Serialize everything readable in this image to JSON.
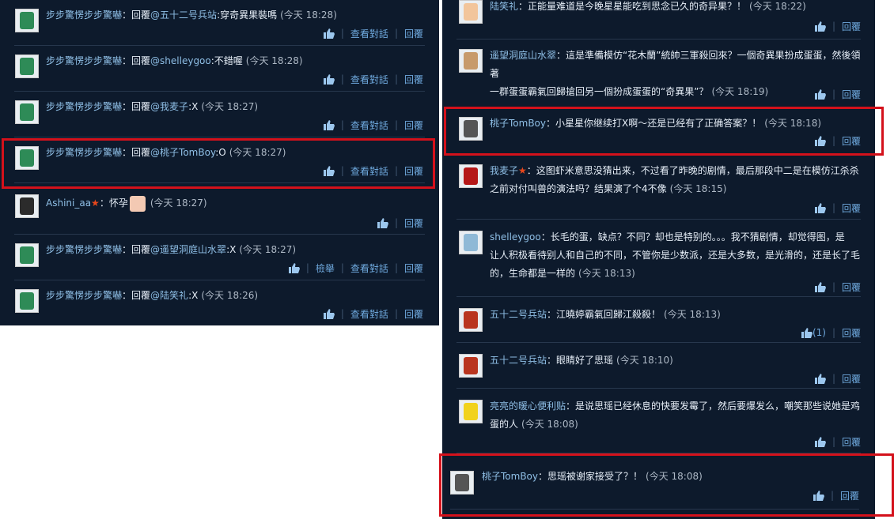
{
  "left": [
    {
      "name": "步步驚愣步步驚嚇",
      "sep": "：",
      "parts": [
        {
          "t": "回覆",
          "c": "text"
        },
        {
          "t": "@五十二号兵站",
          "c": "mention"
        },
        {
          "t": ":穿奇異果裝嗎",
          "c": "text"
        }
      ],
      "time": "(今天 18:28)",
      "actions": [
        "查看對話",
        "回覆"
      ],
      "avatar": "bottle"
    },
    {
      "name": "步步驚愣步步驚嚇",
      "sep": "：",
      "parts": [
        {
          "t": "回覆",
          "c": "text"
        },
        {
          "t": "@shelleygoo",
          "c": "mention"
        },
        {
          "t": ":不錯喔",
          "c": "text"
        }
      ],
      "time": "(今天 18:28)",
      "actions": [
        "查看對話",
        "回覆"
      ],
      "avatar": "bottle"
    },
    {
      "name": "步步驚愣步步驚嚇",
      "sep": "：",
      "parts": [
        {
          "t": "回覆",
          "c": "text"
        },
        {
          "t": "@我麦子",
          "c": "mention"
        },
        {
          "t": ":X",
          "c": "text"
        }
      ],
      "time": "(今天 18:27)",
      "actions": [
        "查看對話",
        "回覆"
      ],
      "avatar": "bottle"
    },
    {
      "name": "步步驚愣步步驚嚇",
      "sep": "：",
      "parts": [
        {
          "t": "回覆",
          "c": "text"
        },
        {
          "t": "@桃子TomBoy",
          "c": "mention"
        },
        {
          "t": ":O",
          "c": "text"
        }
      ],
      "time": "(今天 18:27)",
      "actions": [
        "查看對話",
        "回覆"
      ],
      "avatar": "bottle"
    },
    {
      "name": "Ashini_aa",
      "star": "★",
      "sep": "：",
      "parts": [
        {
          "t": "怀孕",
          "c": "text"
        }
      ],
      "emoji": true,
      "time": "(今天 18:27)",
      "actions": [
        "回覆"
      ],
      "avatar": "dark"
    },
    {
      "name": "步步驚愣步步驚嚇",
      "sep": "：",
      "parts": [
        {
          "t": "回覆",
          "c": "text"
        },
        {
          "t": "@遥望洞庭山水翠",
          "c": "mention"
        },
        {
          "t": ":X",
          "c": "text"
        }
      ],
      "time": "(今天 18:27)",
      "actions": [
        "檢舉",
        "查看對話",
        "回覆"
      ],
      "avatar": "bottle"
    },
    {
      "name": "步步驚愣步步驚嚇",
      "sep": "：",
      "parts": [
        {
          "t": "回覆",
          "c": "text"
        },
        {
          "t": "@陆笑礼",
          "c": "mention"
        },
        {
          "t": ":X",
          "c": "text"
        }
      ],
      "time": "(今天 18:26)",
      "actions": [
        "查看對話",
        "回覆"
      ],
      "avatar": "bottle"
    }
  ],
  "right": [
    {
      "name": "陆笑礼",
      "lines": [
        "正能量难道是今晚星星能吃到思念已久的奇异果？！"
      ],
      "time": "(今天 18:22)",
      "actions": [
        "回覆"
      ],
      "avatar": "cartoon"
    },
    {
      "name": "遥望洞庭山水翠",
      "lines": [
        "這是準備模仿“花木蘭”統帥三軍殺回來？一個奇異果扮成蛋蛋，然後領著",
        "一群蛋蛋霸氣回歸搶回另一個扮成蛋蛋的“奇異果”？"
      ],
      "time": "(今天 18:19)",
      "actions": [
        "回覆"
      ],
      "avatar": "face"
    },
    {
      "name": "桃子TomBoy",
      "lines": [
        "小星星你继续打X啊～还是已经有了正确答案？！"
      ],
      "time": "(今天 18:18)",
      "actions": [
        "回覆"
      ],
      "avatar": "couple"
    },
    {
      "name": "我麦子",
      "star": "★",
      "lines": [
        "这图虾米意思没猜出来，不过看了昨晚的剧情，最后那段中二是在模仿江杀杀",
        "之前对付叫兽的演法吗？结果演了个4不像"
      ],
      "time": "(今天 18:15)",
      "actions": [
        "回覆"
      ],
      "avatar": "red"
    },
    {
      "name": "shelleygoo",
      "lines": [
        "长毛的蛋，缺点？不同？却也是特别的。。。我不猜剧情，却觉得图，是",
        "让人积极看待别人和自己的不同，不管你是少数派，还是大多数，是光滑的，还是长了毛",
        "的，生命都是一样的"
      ],
      "time": "(今天 18:13)",
      "actions": [
        "回覆"
      ],
      "avatar": "sky"
    },
    {
      "name": "五十二号兵站",
      "lines": [
        "江曉婷霸氣回歸江殺殺！"
      ],
      "time": "(今天 18:13)",
      "actions": [
        "(1)",
        "回覆"
      ],
      "avatar": "rose"
    },
    {
      "name": "五十二号兵站",
      "lines": [
        "眼睛好了思瑶"
      ],
      "time": "(今天 18:10)",
      "actions": [
        "回覆"
      ],
      "avatar": "rose"
    },
    {
      "name": "亮亮的暖心便利贴",
      "lines": [
        "是说思瑶已经休息的快要发霉了，然后要爆发么，嘲笑那些说她是鸡",
        "蛋的人"
      ],
      "time": "(今天 18:08)",
      "actions": [
        "回覆"
      ],
      "avatar": "yellow"
    },
    {
      "name": "桃子TomBoy",
      "lines": [
        "思瑶被谢家接受了？！"
      ],
      "time": "(今天 18:08)",
      "actions": [
        "回覆"
      ],
      "avatar": "couple"
    }
  ],
  "colors": {
    "panel": "#0d1a2c",
    "link": "#6fa9de",
    "highlight": "#d4111b"
  }
}
